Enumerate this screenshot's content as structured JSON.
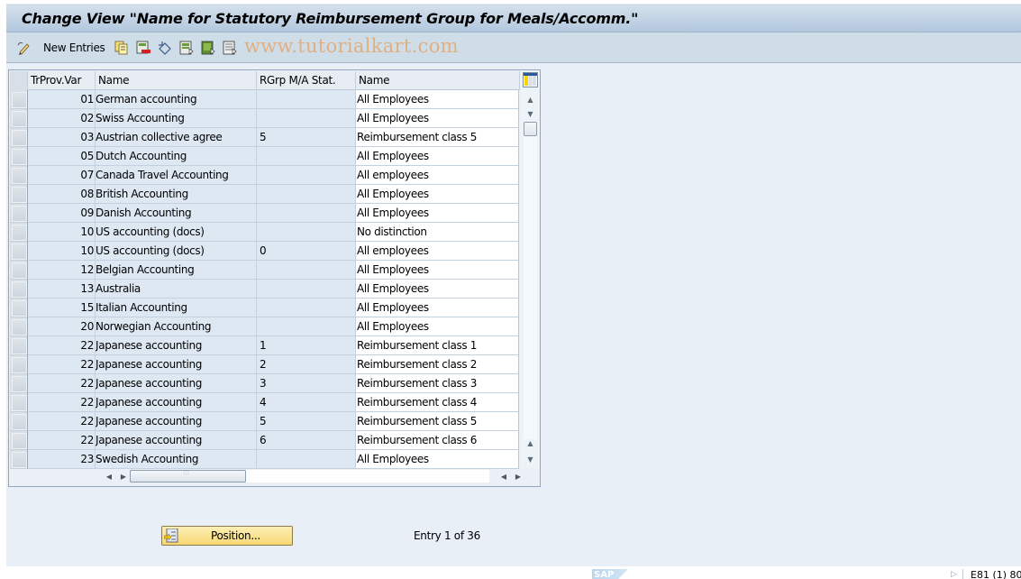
{
  "window": {
    "title": "Change View \"Name for Statutory Reimbursement Group for Meals/Accomm.\""
  },
  "toolbar": {
    "new_entries_label": "New Entries",
    "watermark": "www.tutorialkart.com",
    "icons": [
      "display-change-icon",
      "copy-as-icon",
      "delete-icon",
      "undo-change-icon",
      "select-all-icon",
      "select-block-icon",
      "deselect-all-icon"
    ]
  },
  "table": {
    "columns": [
      "TrProv.Var",
      "Name",
      "RGrp M/A Stat.",
      "Name"
    ],
    "rows": [
      {
        "key": "01",
        "name": "German accounting",
        "rgrp": "",
        "desc": "All Employees"
      },
      {
        "key": "02",
        "name": "Swiss Accounting",
        "rgrp": "",
        "desc": "All Employees"
      },
      {
        "key": "03",
        "name": "Austrian collective agree",
        "rgrp": "5",
        "desc": "Reimbursement class 5"
      },
      {
        "key": "05",
        "name": "Dutch Accounting",
        "rgrp": "",
        "desc": "All Employees"
      },
      {
        "key": "07",
        "name": "Canada Travel Accounting",
        "rgrp": "",
        "desc": "All employees"
      },
      {
        "key": "08",
        "name": "British Accounting",
        "rgrp": "",
        "desc": "All Employees"
      },
      {
        "key": "09",
        "name": "Danish Accounting",
        "rgrp": "",
        "desc": "All Employees"
      },
      {
        "key": "10",
        "name": "US accounting (docs)",
        "rgrp": "",
        "desc": "No distinction"
      },
      {
        "key": "10",
        "name": "US accounting (docs)",
        "rgrp": "0",
        "desc": "All employees"
      },
      {
        "key": "12",
        "name": "Belgian Accounting",
        "rgrp": "",
        "desc": "All Employees"
      },
      {
        "key": "13",
        "name": "Australia",
        "rgrp": "",
        "desc": "All Employees"
      },
      {
        "key": "15",
        "name": "Italian Accounting",
        "rgrp": "",
        "desc": "All Employees"
      },
      {
        "key": "20",
        "name": "Norwegian Accounting",
        "rgrp": "",
        "desc": "All Employees"
      },
      {
        "key": "22",
        "name": "Japanese accounting",
        "rgrp": "1",
        "desc": "Reimbursement class 1"
      },
      {
        "key": "22",
        "name": "Japanese accounting",
        "rgrp": "2",
        "desc": "Reimbursement class 2"
      },
      {
        "key": "22",
        "name": "Japanese accounting",
        "rgrp": "3",
        "desc": "Reimbursement class 3"
      },
      {
        "key": "22",
        "name": "Japanese accounting",
        "rgrp": "4",
        "desc": "Reimbursement class 4"
      },
      {
        "key": "22",
        "name": "Japanese accounting",
        "rgrp": "5",
        "desc": "Reimbursement class 5"
      },
      {
        "key": "22",
        "name": "Japanese accounting",
        "rgrp": "6",
        "desc": "Reimbursement class 6"
      },
      {
        "key": "23",
        "name": "Swedish Accounting",
        "rgrp": "",
        "desc": "All Employees"
      }
    ]
  },
  "footer": {
    "position_label": "Position...",
    "entry_info": "Entry 1 of 36"
  },
  "status": {
    "logo": "SAP",
    "system": "E81 (1) 80"
  },
  "colors": {
    "title_bar": "#b3c8de",
    "toolbar": "#cfdde8",
    "background": "#e8eff7",
    "key_cells": "#dde8f3",
    "button": "#f7d873"
  }
}
